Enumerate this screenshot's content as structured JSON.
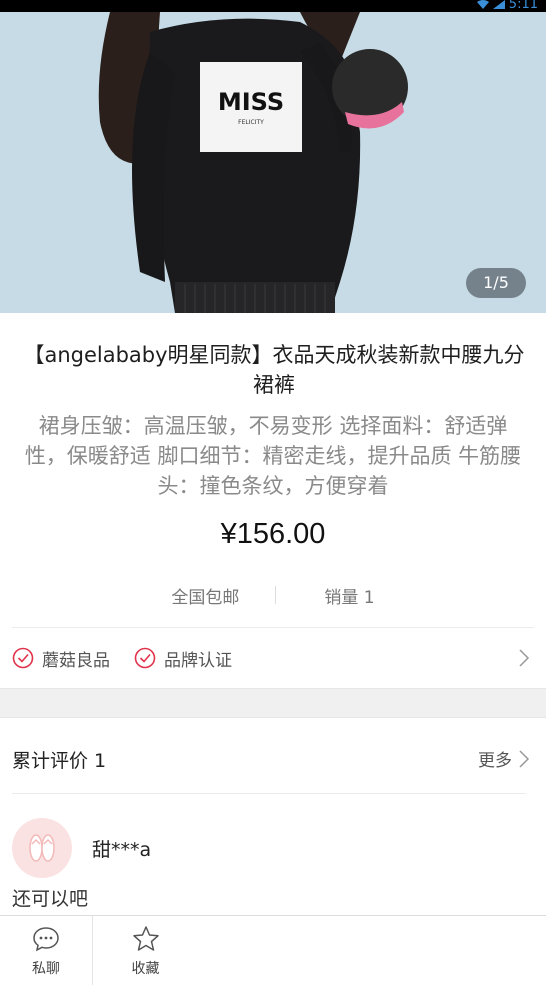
{
  "status_bar": {
    "time": "5:11"
  },
  "product": {
    "image_pager": "1/5",
    "title": "【angelababy明星同款】衣品天成秋装新款中腰九分裙裤",
    "description": "裙身压皱：高温压皱，不易变形 选择面料：舒适弹性，保暖舒适 脚口细节：精密走线，提升品质 牛筋腰头：撞色条纹，方便穿着",
    "price": "¥156.00",
    "shipping": "全国包邮",
    "sales": "销量 1",
    "shirt_print": "MISS",
    "shirt_print_sub": "FELICITY"
  },
  "badges": [
    {
      "label": "蘑菇良品",
      "icon": "check-circle-icon"
    },
    {
      "label": "品牌认证",
      "icon": "check-circle-icon"
    }
  ],
  "reviews": {
    "heading": "累计评价 1",
    "more_label": "更多",
    "items": [
      {
        "user": "甜***a",
        "text": "还可以吧"
      }
    ]
  },
  "bottom_bar": {
    "chat_label": "私聊",
    "favorite_label": "收藏"
  },
  "colors": {
    "accent": "#e0334b",
    "muted": "#8a8a8a"
  }
}
